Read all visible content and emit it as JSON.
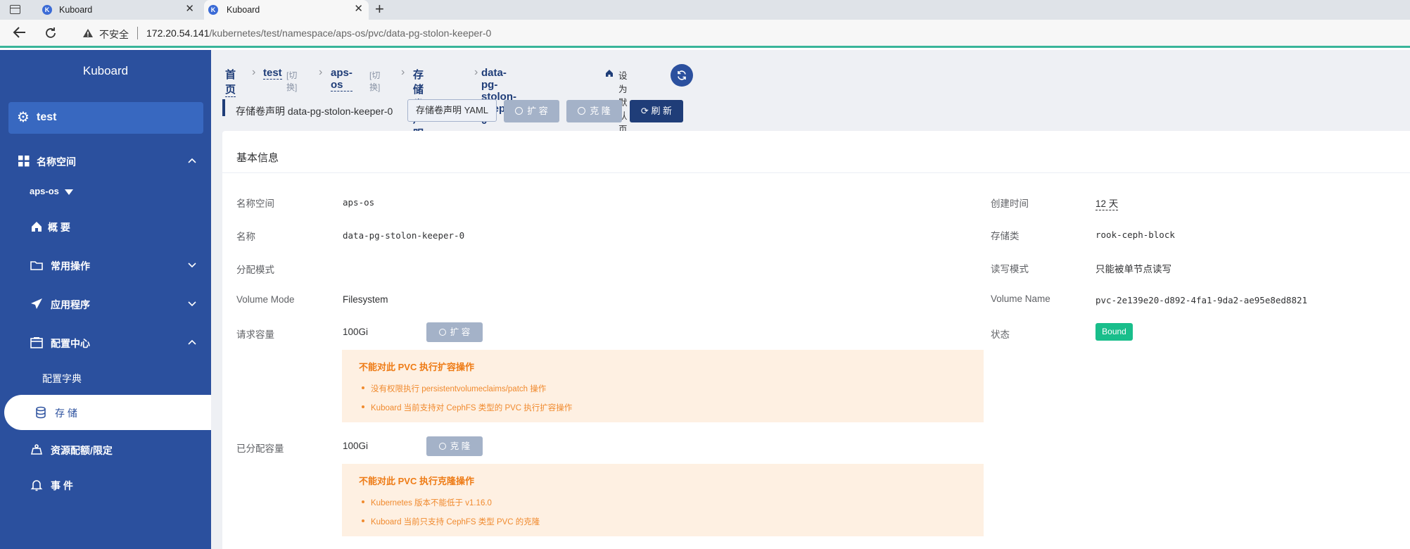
{
  "browser": {
    "tabs": [
      {
        "title": "Kuboard",
        "favicon": "K"
      },
      {
        "title": "Kuboard",
        "favicon": "K"
      }
    ],
    "insecure_label": "不安全",
    "url_host": "172.20.54.141",
    "url_path": "/kubernetes/test/namespace/aps-os/pvc/data-pg-stolon-keeper-0",
    "new_tab": "+",
    "close_glyph": "✕"
  },
  "sidebar": {
    "title": "Kuboard",
    "cluster": "test",
    "namespace_section": "名称空间",
    "namespace": "aps-os",
    "items": [
      {
        "label": "概 要",
        "icon": "home-icon"
      },
      {
        "label": "常用操作",
        "icon": "folder-icon"
      },
      {
        "label": "应用程序",
        "icon": "send-icon"
      },
      {
        "label": "配置中心",
        "icon": "window-icon"
      },
      {
        "label": "配置字典",
        "icon": ""
      },
      {
        "label": "存 储",
        "icon": "database-icon"
      },
      {
        "label": "资源配额/限定",
        "icon": "scale-icon"
      },
      {
        "label": "事 件",
        "icon": "bell-icon"
      }
    ]
  },
  "breadcrumb": {
    "home": "首页",
    "cluster": "test",
    "cluster_switch": "[切换]",
    "namespace": "aps-os",
    "namespace_switch": "[切换]",
    "kind": "存储卷声明",
    "current": "data-pg-stolon-keeper-0",
    "set_default": "设为默认页"
  },
  "toolbar": {
    "title": "存储卷声明 data-pg-stolon-keeper-0",
    "yaml_button": "存储卷声明 YAML",
    "expand_button": "扩 容",
    "clone_button": "克 隆",
    "refresh_button": "刷 新"
  },
  "basic_info": {
    "section_title": "基本信息",
    "left": {
      "namespace_label": "名称空间",
      "namespace_value": "aps-os",
      "name_label": "名称",
      "name_value": "data-pg-stolon-keeper-0",
      "provision_label": "分配模式",
      "provision_value": "",
      "volume_mode_label": "Volume Mode",
      "volume_mode_value": "Filesystem",
      "request_label": "请求容量",
      "request_value": "100Gi",
      "request_button": "扩 容",
      "allocated_label": "已分配容量",
      "allocated_value": "100Gi",
      "allocated_button": "克 隆"
    },
    "right": {
      "created_label": "创建时间",
      "created_value": "12 天",
      "storage_class_label": "存储类",
      "storage_class_value": "rook-ceph-block",
      "access_mode_label": "读写模式",
      "access_mode_value": "只能被单节点读写",
      "volume_name_label": "Volume Name",
      "volume_name_value": "pvc-2e139e20-d892-4fa1-9da2-ae95e8ed8821",
      "status_label": "状态",
      "status_value": "Bound"
    },
    "expand_warning": {
      "title": "不能对此 PVC 执行扩容操作",
      "items": [
        "没有权限执行 persistentvolumeclaims/patch 操作",
        "Kuboard 当前支持对 CephFS 类型的 PVC 执行扩容操作"
      ]
    },
    "clone_warning": {
      "title": "不能对此 PVC 执行克隆操作",
      "items": [
        "Kubernetes 版本不能低于 v1.16.0",
        "Kuboard 当前只支持 CephFS 类型 PVC 的克隆"
      ]
    }
  },
  "colors": {
    "sidebar": "#2b509e",
    "primary": "#1f3d78",
    "accent_bar": "#39b59a",
    "status_bound": "#19be8b",
    "warning_bg": "#fef0e2",
    "warning_text": "#ee7b15"
  }
}
